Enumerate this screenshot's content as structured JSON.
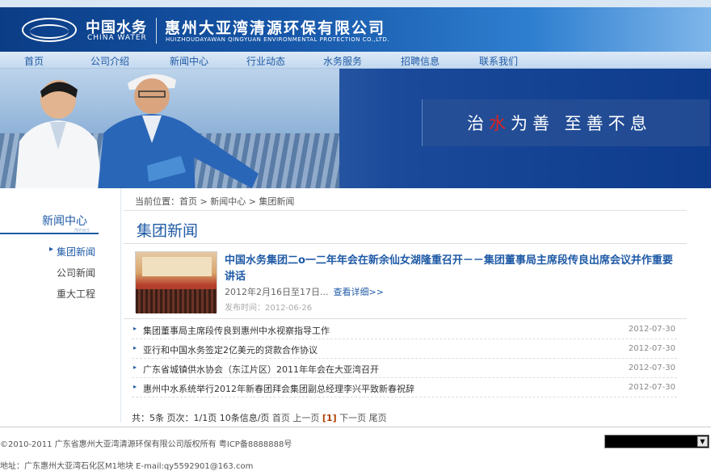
{
  "header": {
    "logo_cn": "中国水务",
    "logo_en": "CHINA WATER",
    "company_cn": "惠州大亚湾清源环保有限公司",
    "company_en": "HUIZHOUDAYAWAN QINGYUAN ENVIRONMENTAL PROTECTION CO.,LTD."
  },
  "nav": {
    "items": [
      "首页",
      "公司介绍",
      "新闻中心",
      "行业动态",
      "水务服务",
      "招聘信息",
      "联系我们"
    ]
  },
  "banner": {
    "slogan_part1": "治",
    "slogan_red": "水",
    "slogan_part2": "为善  至善不息"
  },
  "sidebar": {
    "title": "新闻中心",
    "title_en": "News",
    "items": [
      "集团新闻",
      "公司新闻",
      "重大工程"
    ]
  },
  "breadcrumb": "当前位置：首页 > 新闻中心 > 集团新闻",
  "section_title": "集团新闻",
  "feature": {
    "title": "中国水务集团二o一二年年会在新余仙女湖隆重召开－－集团董事局主席段传良出席会议并作重要讲话",
    "summary": "2012年2月16日至17日...",
    "more": "查看详细>>",
    "date": "发布时间：2012-06-26"
  },
  "news": [
    {
      "title": "集团董事局主席段传良到惠州中水视察指导工作",
      "date": "2012-07-30"
    },
    {
      "title": "亚行和中国水务签定2亿美元的贷款合作协议",
      "date": "2012-07-30"
    },
    {
      "title": "广东省城镇供水协会（东江片区）2011年年会在大亚湾召开",
      "date": "2012-07-30"
    },
    {
      "title": "惠州中水系统举行2012年新春团拜会集团副总经理李兴平致新春祝辞",
      "date": "2012-07-30"
    }
  ],
  "pager": {
    "summary": "共：5条 页次：1/1页  10条信息/页",
    "first": "首页",
    "prev": "上一页",
    "current": "[1]",
    "next": "下一页",
    "last": "尾页"
  },
  "footer": {
    "copyright": "©2010-2011 广东省惠州大亚湾清源环保有限公司版权所有 粤ICP备8888888号",
    "address": "地址：广东惠州大亚湾石化区M1地块 E-mail:qy5592901@163.com"
  }
}
